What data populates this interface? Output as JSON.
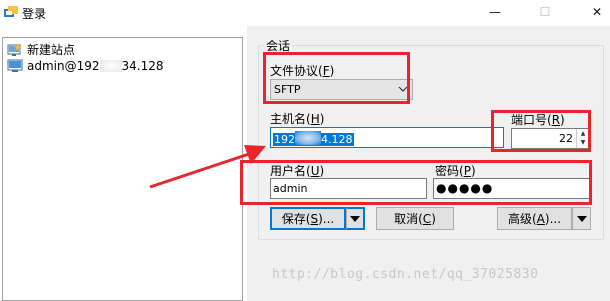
{
  "window": {
    "title": "登录",
    "minimize": "—",
    "maximize": "☐",
    "close": "✕"
  },
  "sessions": {
    "new_site": "新建站点",
    "site_prefix": "admin@192",
    "site_suffix": "34.128"
  },
  "session_group": {
    "label": "会话",
    "protocol_label": "文件协议(",
    "protocol_key": "F",
    "protocol_value": "SFTP",
    "host_label": "主机名(",
    "host_key": "H",
    "host_prefix": "192",
    "host_suffix": "4.128",
    "port_label": "端口号(",
    "port_key": "R",
    "port_value": "22",
    "user_label": "用户名(",
    "user_key": "U",
    "user_value": "admin",
    "password_label": "密码(",
    "password_key": "P",
    "password_value": "●●●●●",
    "label_close": ")"
  },
  "buttons": {
    "save": "保存(",
    "save_key": "S",
    "save_suffix": ")...",
    "cancel": "取消(",
    "cancel_key": "C",
    "cancel_suffix": ")",
    "advanced": "高级(",
    "advanced_key": "A",
    "advanced_suffix": ")..."
  },
  "watermark": "http://blog.csdn.net/qq_37025830",
  "colors": {
    "annotation": "#e8252a",
    "selection": "#0078d7"
  }
}
